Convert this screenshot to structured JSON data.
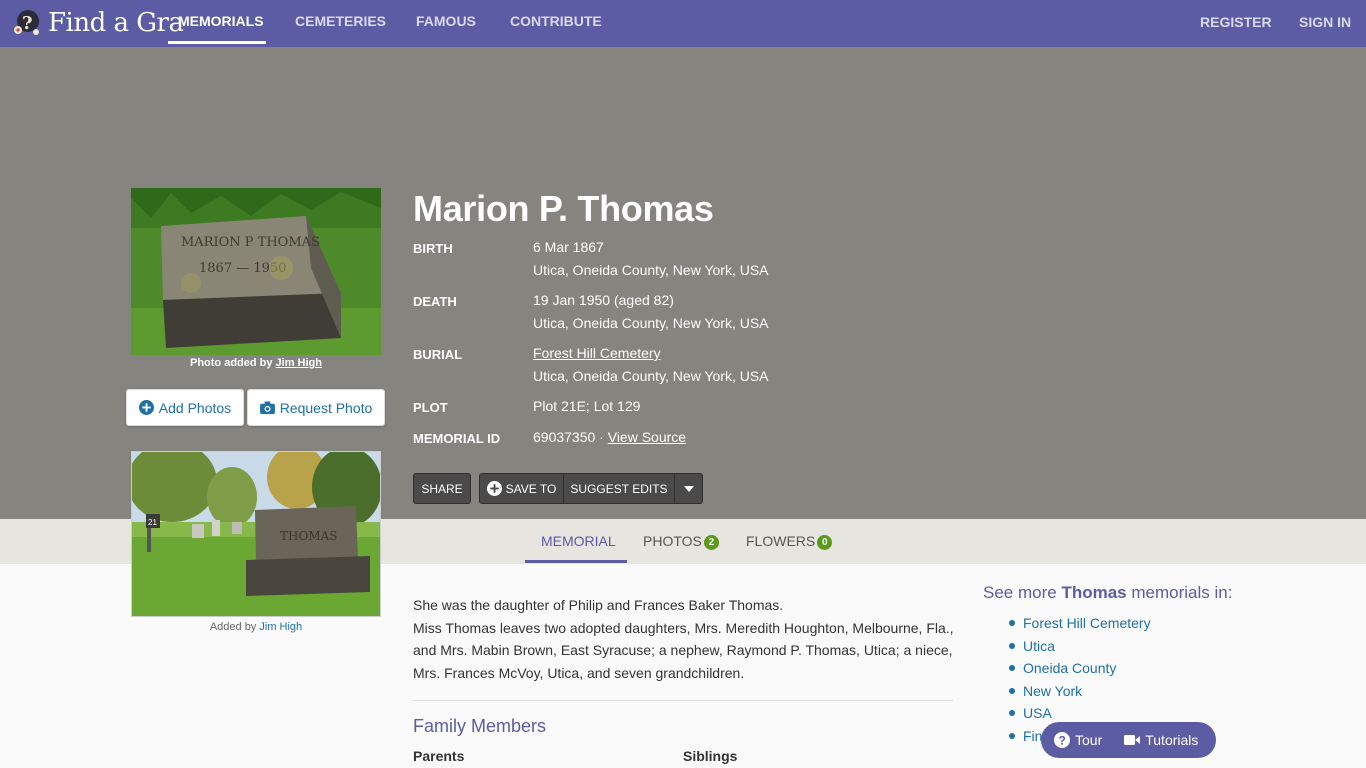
{
  "brand": {
    "logo_text": "Find a Gra"
  },
  "nav": {
    "items": [
      {
        "label": "MEMORIALS"
      },
      {
        "label": "CEMETERIES"
      },
      {
        "label": "FAMOUS"
      },
      {
        "label": "CONTRIBUTE"
      }
    ],
    "register": "REGISTER",
    "sign_in": "SIGN IN"
  },
  "memorial": {
    "name": "Marion P. Thomas",
    "photo_credit_prefix": "Photo added by",
    "photo_credit_user": "Jim High",
    "add_photos": "Add Photos",
    "request_photo": "Request Photo",
    "facts": {
      "birth_label": "BIRTH",
      "birth_date": "6 Mar 1867",
      "birth_place": "Utica, Oneida County, New York, USA",
      "death_label": "DEATH",
      "death_date": "19 Jan 1950 (aged 82)",
      "death_place": "Utica, Oneida County, New York, USA",
      "burial_label": "BURIAL",
      "burial_cemetery": "Forest Hill Cemetery",
      "burial_place": "Utica, Oneida County, New York, USA",
      "plot_label": "PLOT",
      "plot_value": "Plot 21E; Lot 129",
      "id_label": "MEMORIAL ID",
      "id_value": "69037350 ·",
      "view_source": "View Source"
    },
    "actions": {
      "share": "SHARE",
      "save_to": "SAVE TO",
      "suggest_edits": "SUGGEST EDITS"
    }
  },
  "tabs": {
    "memorial": "MEMORIAL",
    "photos": "PHOTOS",
    "photos_count": "2",
    "flowers": "FLOWERS",
    "flowers_count": "0"
  },
  "second_photo": {
    "credit_prefix": "Added by",
    "credit_user": "Jim High"
  },
  "bio": {
    "line1": "She was the daughter of Philip and Frances Baker Thomas.",
    "line2": "Miss Thomas leaves two adopted daughters, Mrs. Meredith Houghton, Melbourne, Fla., and Mrs. Mabin Brown, East Syracuse; a nephew, Raymond P. Thomas, Utica; a niece, Mrs. Frances McVoy, Utica, and seven grandchildren."
  },
  "family": {
    "title": "Family Members",
    "parents": "Parents",
    "siblings": "Siblings"
  },
  "see_more": {
    "prefix": "See more",
    "surname": "Thomas",
    "suffix": "memorials in:",
    "links": [
      "Forest Hill Cemetery",
      "Utica",
      "Oneida County",
      "New York",
      "USA",
      "Fin"
    ]
  },
  "help": {
    "tour": "Tour",
    "tutorials": "Tutorials"
  },
  "colors": {
    "brand": "#5b5ca3",
    "hero_bg": "#85847f",
    "link": "#1f6fa8",
    "badge": "#5a9b1e"
  }
}
